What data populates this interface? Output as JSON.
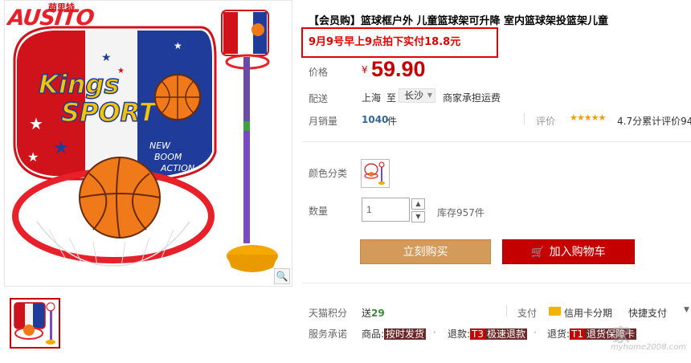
{
  "product": {
    "title": "【会员购】篮球框户外 儿童篮球架可升降 室内篮球架投篮架儿童",
    "promo": "9月9号早上9点拍下实付18.8元",
    "brand_logo": "AUSITO",
    "brand_cn": "萌思特",
    "board_text_1": "Kings",
    "board_text_2": "SPORT",
    "board_text_3": "NEW",
    "board_text_4": "BOOM",
    "board_text_5": "ACTION"
  },
  "price": {
    "label": "价格",
    "currency": "¥",
    "value": "59.90"
  },
  "shipping": {
    "label": "配送",
    "from": "上海",
    "to": "至",
    "region": "长沙",
    "note": "商家承担运费"
  },
  "sales": {
    "label": "月销量",
    "count": "1040",
    "unit": "件"
  },
  "rating": {
    "label": "评价",
    "stars": "★★★★★",
    "text": "4.7分累计评价94"
  },
  "color": {
    "label": "颜色分类"
  },
  "quantity": {
    "label": "数量",
    "value": "1",
    "stock": "库存957件"
  },
  "actions": {
    "buy": "立刻购买",
    "cart": "加入购物车",
    "cart_icon": "cart-icon"
  },
  "points": {
    "label": "天猫积分",
    "prefix": "送",
    "value": "29"
  },
  "payment": {
    "label": "支付",
    "credit": "信用卡分期",
    "quick": "快捷支付",
    "arrow": "▼"
  },
  "service": {
    "label": "服务承诺",
    "item1_prefix": "商品:",
    "item1_tag": "按时发货",
    "item2_prefix": "退款:",
    "item2_badge": "T3",
    "item2_tag": "极速退款",
    "item3_prefix": "退货:",
    "item3_badge": "T1",
    "item3_tag": "退货保障卡"
  },
  "watermark": {
    "main": "家",
    "url": "myhome2008.com"
  },
  "colors": {
    "accent": "#c40000",
    "buy": "#d49a5a",
    "promo_border": "#e00000"
  }
}
